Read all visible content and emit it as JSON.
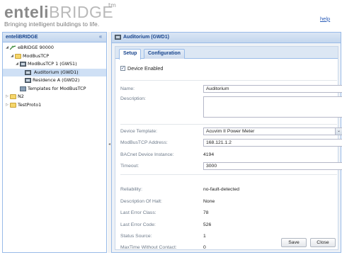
{
  "header": {
    "logo_part1": "enteli",
    "logo_part2": "BRIDGE",
    "logo_tm": "tm",
    "tagline": "Bringing intelligent buildings to life.",
    "help_label": "help"
  },
  "left_panel": {
    "title": "enteliBRIDGE",
    "collapse_icon": "«",
    "tree": [
      {
        "label": "eBRIDGE 90000",
        "twisty": "◢",
        "icon": "network-icon"
      },
      {
        "label": "ModBusTCP",
        "twisty": "◢",
        "icon": "folder-icon"
      },
      {
        "label": "ModBusTCP 1 (GWS1)",
        "twisty": "◢",
        "icon": "gateway-icon"
      },
      {
        "label": "Auditorium (GWD1)",
        "twisty": "",
        "icon": "device-icon",
        "selected": true
      },
      {
        "label": "Residence A (GWD2)",
        "twisty": "",
        "icon": "device-icon"
      },
      {
        "label": "Templates for ModBusTCP",
        "twisty": "",
        "icon": "template-icon"
      },
      {
        "label": "N2",
        "twisty": "▷",
        "icon": "folder-icon"
      },
      {
        "label": "TestProto1",
        "twisty": "▷",
        "icon": "folder-icon"
      }
    ]
  },
  "right_panel": {
    "title": "Auditorium (GWD1)",
    "tabs": [
      {
        "label": "Setup",
        "active": true
      },
      {
        "label": "Configuration",
        "active": false
      }
    ],
    "device_enabled_label": "Device Enabled",
    "device_enabled_mark": "✓",
    "fields": {
      "name": {
        "label": "Name:",
        "value": "Auditorium"
      },
      "description": {
        "label": "Description:",
        "value": ""
      },
      "device_template": {
        "label": "Device Template:",
        "value": "Acuvim II Power Meter",
        "arrow": "⌄"
      },
      "modbus_address": {
        "label": "ModBusTCP Address:",
        "value": "168.121.1.2"
      },
      "bacnet_instance": {
        "label": "BACnet Device Instance:",
        "value": "4194"
      },
      "timeout": {
        "label": "Timeout:",
        "value": "3000"
      }
    },
    "status": {
      "reliability": {
        "label": "Reliability:",
        "value": "no-fault-detected"
      },
      "halt_description": {
        "label": "Description Of Halt:",
        "value": "None"
      },
      "last_error_class": {
        "label": "Last Error Class:",
        "value": "78"
      },
      "last_error_code": {
        "label": "Last Error Code:",
        "value": "526"
      },
      "status_source": {
        "label": "Status Source:",
        "value": "1"
      },
      "max_time": {
        "label": "MaxTime Without Contact:",
        "value": "0"
      }
    },
    "buttons": {
      "save": "Save",
      "close": "Close"
    }
  }
}
